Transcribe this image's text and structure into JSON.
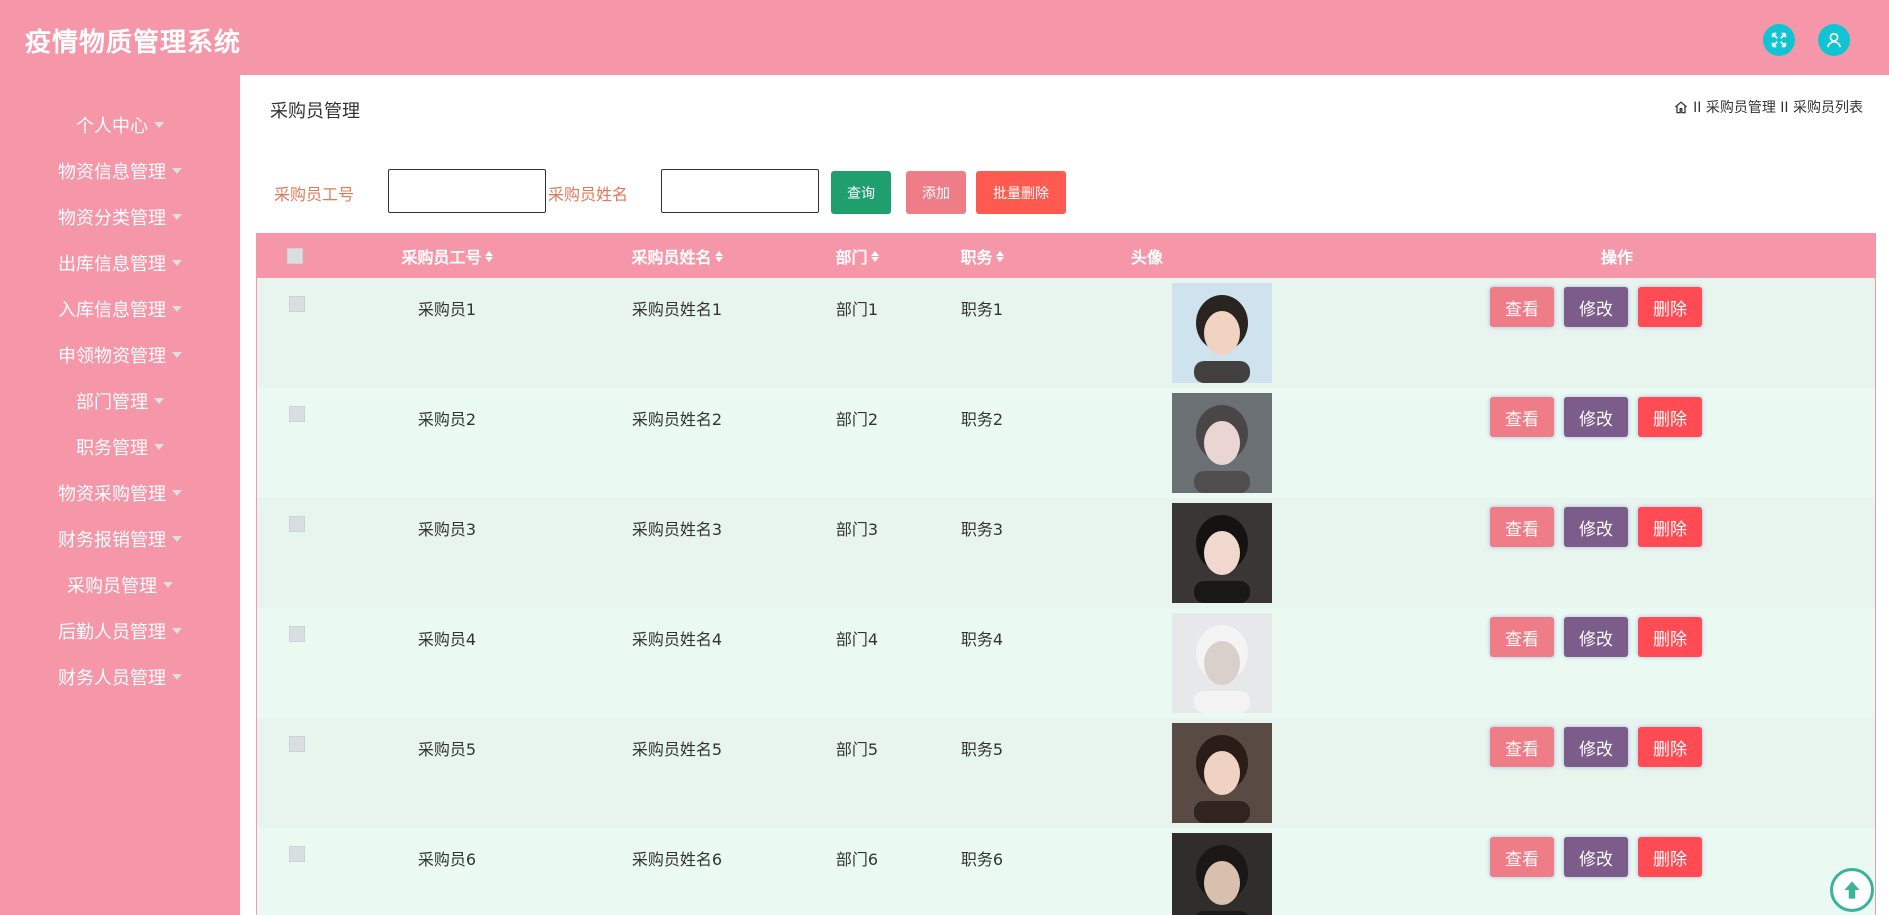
{
  "app": {
    "title": "疫情物质管理系统"
  },
  "header": {
    "icons": [
      "fullscreen-icon",
      "user-icon"
    ],
    "accent": "#10c4d4"
  },
  "sidebar": {
    "items": [
      {
        "label": "个人中心"
      },
      {
        "label": "物资信息管理"
      },
      {
        "label": "物资分类管理"
      },
      {
        "label": "出库信息管理"
      },
      {
        "label": "入库信息管理"
      },
      {
        "label": "申领物资管理"
      },
      {
        "label": "部门管理"
      },
      {
        "label": "职务管理"
      },
      {
        "label": "物资采购管理"
      },
      {
        "label": "财务报销管理"
      },
      {
        "label": "采购员管理"
      },
      {
        "label": "后勤人员管理"
      },
      {
        "label": "财务人员管理"
      }
    ]
  },
  "page": {
    "title": "采购员管理",
    "breadcrumb": "II 采购员管理 II 采购员列表"
  },
  "search": {
    "id_label": "采购员工号",
    "id_value": "",
    "name_label": "采购员姓名",
    "name_value": "",
    "query_label": "查询",
    "add_label": "添加",
    "bulk_delete_label": "批量删除"
  },
  "table": {
    "headers": {
      "id": "采购员工号",
      "name": "采购员姓名",
      "dept": "部门",
      "position": "职务",
      "avatar": "头像",
      "actions": "操作"
    },
    "action_labels": {
      "view": "查看",
      "edit": "修改",
      "delete": "删除"
    },
    "rows": [
      {
        "id": "采购员1",
        "name": "采购员姓名1",
        "dept": "部门1",
        "position": "职务1"
      },
      {
        "id": "采购员2",
        "name": "采购员姓名2",
        "dept": "部门2",
        "position": "职务2"
      },
      {
        "id": "采购员3",
        "name": "采购员姓名3",
        "dept": "部门3",
        "position": "职务3"
      },
      {
        "id": "采购员4",
        "name": "采购员姓名4",
        "dept": "部门4",
        "position": "职务4"
      },
      {
        "id": "采购员5",
        "name": "采购员姓名5",
        "dept": "部门5",
        "position": "职务5"
      },
      {
        "id": "采购员6",
        "name": "采购员姓名6",
        "dept": "部门6",
        "position": "职务6"
      }
    ]
  },
  "colors": {
    "primary": "#f596a9",
    "query": "#1f9e6e",
    "add": "#ee7d87",
    "bulk_delete": "#ff5a4f",
    "edit": "#7c5c8a",
    "delete": "#ff4b53"
  }
}
